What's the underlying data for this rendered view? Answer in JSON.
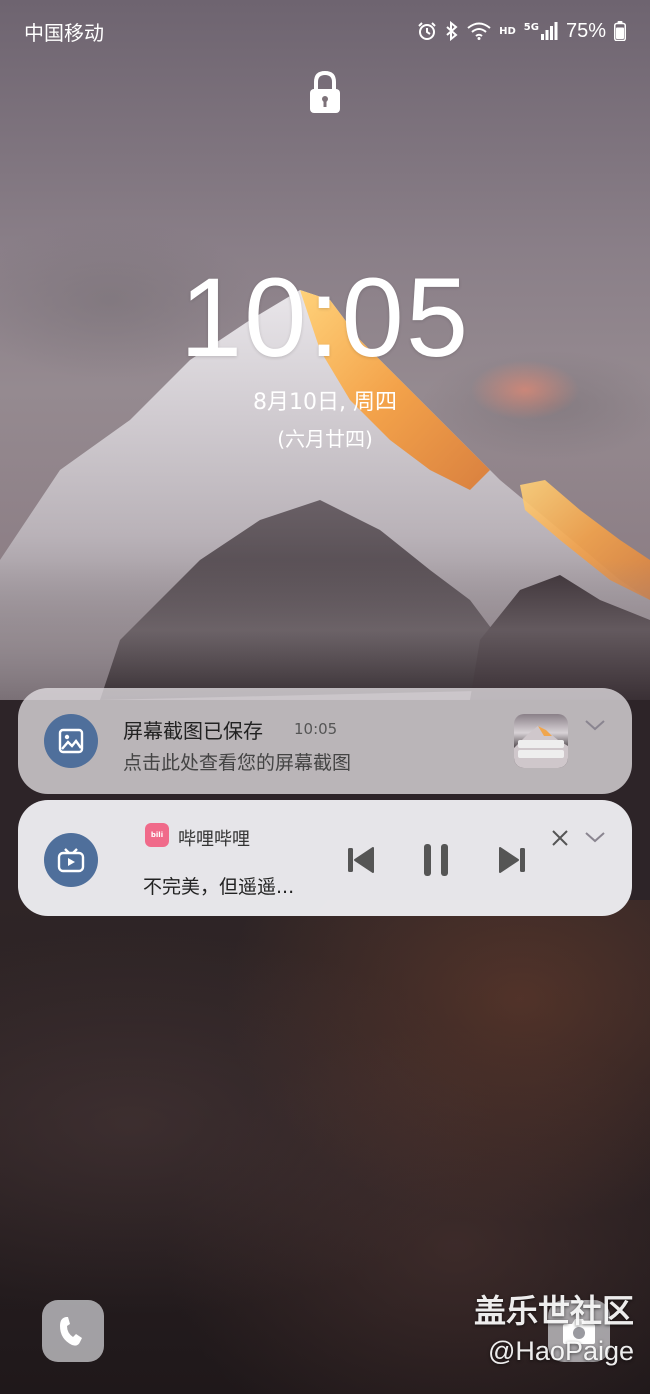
{
  "status_bar": {
    "carrier": "中国移动",
    "icons": [
      "alarm-icon",
      "bluetooth-icon",
      "wifi-icon",
      "hd-icon",
      "signal-5g-icon",
      "battery-icon"
    ],
    "hd_label": "HD",
    "network_label": "5G",
    "battery_percent": "75%"
  },
  "lockscreen": {
    "lock_icon": "lock-icon",
    "time": "10:05",
    "date": "8月10日, 周四",
    "lunar_date": "(六月廿四)"
  },
  "notifications": [
    {
      "app_icon": "image-icon",
      "title": "屏幕截图已保存",
      "time": "10:05",
      "text": "点击此处查看您的屏幕截图",
      "has_thumbnail": true,
      "expand_icon": "chevron-down-icon"
    },
    {
      "app_icon": "bilibili-tv-icon",
      "app_badge": "bilibili",
      "app_name": "哔哩哔哩",
      "song_title": "不完美，但遥遥...",
      "controls": [
        "previous-icon",
        "pause-icon",
        "next-icon"
      ],
      "close_icon": "close-icon",
      "expand_icon": "chevron-down-icon"
    }
  ],
  "shortcuts": {
    "left": "phone-icon",
    "right": "camera-icon"
  },
  "watermark": {
    "title": "盖乐世社区",
    "handle": "@HaoPaige"
  },
  "colors": {
    "app_icon_bg": "#4f6f9b",
    "bilibili_pink": "#f06a8a",
    "notification_bg": "#f0f0f3"
  }
}
